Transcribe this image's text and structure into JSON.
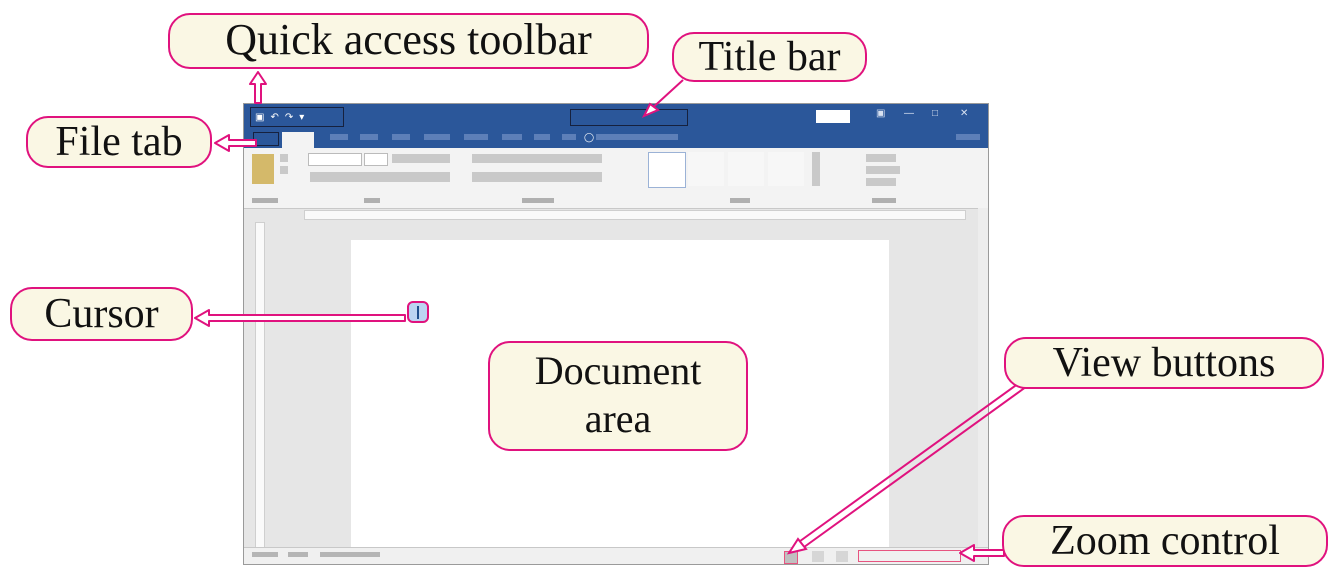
{
  "callouts": {
    "quick_access_toolbar": "Quick access toolbar",
    "title_bar": "Title bar",
    "file_tab": "File tab",
    "cursor": "Cursor",
    "document_area_line1": "Document",
    "document_area_line2": "area",
    "view_buttons": "View buttons",
    "zoom_control": "Zoom control"
  },
  "colors": {
    "callout_border": "#e0127e",
    "callout_fill": "#faf7e4",
    "word_blue": "#2b579a"
  }
}
